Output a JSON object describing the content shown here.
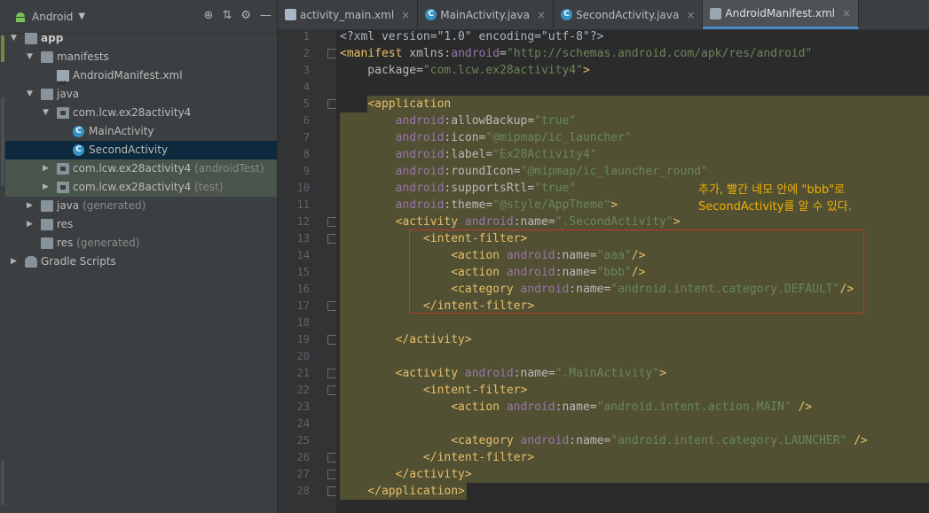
{
  "project_panel": {
    "view_label": "Android",
    "tree": [
      {
        "label": "app",
        "suffix": "",
        "depth": 0,
        "arrow": "down",
        "icon": "app-module-icon",
        "bold": true
      },
      {
        "label": "manifests",
        "suffix": "",
        "depth": 1,
        "arrow": "down",
        "icon": "folder-icon"
      },
      {
        "label": "AndroidManifest.xml",
        "suffix": "",
        "depth": 2,
        "arrow": "",
        "icon": "manifest-file-icon"
      },
      {
        "label": "java",
        "suffix": "",
        "depth": 1,
        "arrow": "down",
        "icon": "folder-icon"
      },
      {
        "label": "com.lcw.ex28activity4",
        "suffix": "",
        "depth": 2,
        "arrow": "down",
        "icon": "package-icon"
      },
      {
        "label": "MainActivity",
        "suffix": "",
        "depth": 3,
        "arrow": "",
        "icon": "class-icon"
      },
      {
        "label": "SecondActivity",
        "suffix": "",
        "depth": 3,
        "arrow": "",
        "icon": "class-icon",
        "selected": true
      },
      {
        "label": "com.lcw.ex28activity4",
        "suffix": " (androidTest)",
        "depth": 2,
        "arrow": "right",
        "icon": "package-icon",
        "test": true
      },
      {
        "label": "com.lcw.ex28activity4",
        "suffix": " (test)",
        "depth": 2,
        "arrow": "right",
        "icon": "package-icon",
        "test": true
      },
      {
        "label": "java",
        "suffix": " (generated)",
        "depth": 1,
        "arrow": "right",
        "icon": "folder-icon"
      },
      {
        "label": "res",
        "suffix": "",
        "depth": 1,
        "arrow": "right",
        "icon": "folder-icon"
      },
      {
        "label": "res",
        "suffix": " (generated)",
        "depth": 1,
        "arrow": "",
        "icon": "folder-icon"
      },
      {
        "label": "Gradle Scripts",
        "suffix": "",
        "depth": 0,
        "arrow": "right",
        "icon": "gradle-icon"
      }
    ]
  },
  "tabs": [
    {
      "label": "activity_main.xml",
      "icon": "xml",
      "active": false
    },
    {
      "label": "MainActivity.java",
      "icon": "class",
      "active": false
    },
    {
      "label": "SecondActivity.java",
      "icon": "class",
      "active": false
    },
    {
      "label": "AndroidManifest.xml",
      "icon": "manifest",
      "active": true
    }
  ],
  "tab_close_glyph": "×",
  "editor": {
    "lines": [
      [
        [
          "<?xml version=\"1.0\" encoding=\"utf-8\"?>",
          "p"
        ]
      ],
      [
        [
          "<manifest ",
          "t"
        ],
        [
          "xmlns:",
          "a"
        ],
        [
          "android",
          "ns"
        ],
        [
          "=",
          "a"
        ],
        [
          "\"http://schemas.android.com/apk/res/android\"",
          "v"
        ]
      ],
      [
        [
          "    package",
          "a"
        ],
        [
          "=",
          "a"
        ],
        [
          "\"com.lcw.ex28activity4\"",
          "v"
        ],
        [
          ">",
          "t"
        ]
      ],
      [],
      [
        [
          "    <application",
          "t"
        ]
      ],
      [
        [
          "        android",
          "ns"
        ],
        [
          ":allowBackup=",
          "a"
        ],
        [
          "\"true\"",
          "v"
        ]
      ],
      [
        [
          "        android",
          "ns"
        ],
        [
          ":icon=",
          "a"
        ],
        [
          "\"@mipmap/ic_launcher\"",
          "v"
        ]
      ],
      [
        [
          "        android",
          "ns"
        ],
        [
          ":label=",
          "a"
        ],
        [
          "\"Ex28Activity4\"",
          "v"
        ]
      ],
      [
        [
          "        android",
          "ns"
        ],
        [
          ":roundIcon=",
          "a"
        ],
        [
          "\"@mipmap/ic_launcher_round\"",
          "v"
        ]
      ],
      [
        [
          "        android",
          "ns"
        ],
        [
          ":supportsRtl=",
          "a"
        ],
        [
          "\"true\"",
          "v"
        ]
      ],
      [
        [
          "        android",
          "ns"
        ],
        [
          ":theme=",
          "a"
        ],
        [
          "\"@style/AppTheme\"",
          "v"
        ],
        [
          ">",
          "t"
        ]
      ],
      [
        [
          "        <activity ",
          "t"
        ],
        [
          "android",
          "ns"
        ],
        [
          ":name=",
          "a"
        ],
        [
          "\".SecondActivity\"",
          "v"
        ],
        [
          ">",
          "t"
        ]
      ],
      [
        [
          "            <intent-filter>",
          "t"
        ]
      ],
      [
        [
          "                <action ",
          "t"
        ],
        [
          "android",
          "ns"
        ],
        [
          ":name=",
          "a"
        ],
        [
          "\"aaa\"",
          "v"
        ],
        [
          "/>",
          "t"
        ]
      ],
      [
        [
          "                <action ",
          "t"
        ],
        [
          "android",
          "ns"
        ],
        [
          ":name=",
          "a"
        ],
        [
          "\"bbb\"",
          "v"
        ],
        [
          "/>",
          "t"
        ]
      ],
      [
        [
          "                <category ",
          "t"
        ],
        [
          "android",
          "ns"
        ],
        [
          ":name=",
          "a"
        ],
        [
          "\"android.intent.category.DEFAULT\"",
          "v"
        ],
        [
          "/>",
          "t"
        ]
      ],
      [
        [
          "            </intent-filter>",
          "t"
        ]
      ],
      [],
      [
        [
          "        </activity>",
          "t"
        ]
      ],
      [],
      [
        [
          "        <activity ",
          "t"
        ],
        [
          "android",
          "ns"
        ],
        [
          ":name=",
          "a"
        ],
        [
          "\".MainActivity\"",
          "v"
        ],
        [
          ">",
          "t"
        ]
      ],
      [
        [
          "            <intent-filter>",
          "t"
        ]
      ],
      [
        [
          "                <action ",
          "t"
        ],
        [
          "android",
          "ns"
        ],
        [
          ":name=",
          "a"
        ],
        [
          "\"android.intent.action.MAIN\"",
          "v"
        ],
        [
          " />",
          "t"
        ]
      ],
      [],
      [
        [
          "                <category ",
          "t"
        ],
        [
          "android",
          "ns"
        ],
        [
          ":name=",
          "a"
        ],
        [
          "\"android.intent.category.LAUNCHER\"",
          "v"
        ],
        [
          " />",
          "t"
        ]
      ],
      [
        [
          "            </intent-filter>",
          "t"
        ]
      ],
      [
        [
          "        </activity>",
          "t"
        ]
      ],
      [
        [
          "    </application>",
          "t"
        ]
      ]
    ]
  },
  "annotation": {
    "line1": "추가, 빨간 네모 안에 \"bbb\"로",
    "line2": "SecondActivity를 알 수 있다."
  },
  "colors": {
    "highlight": "#515033",
    "annotation": "#f0b000",
    "red_box": "#c0392b"
  }
}
